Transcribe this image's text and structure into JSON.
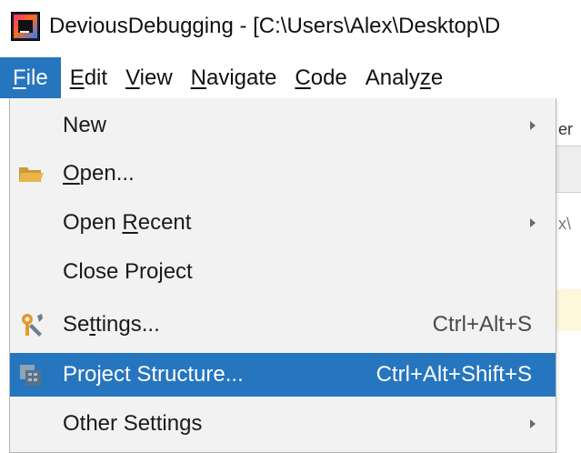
{
  "window": {
    "title": "DeviousDebugging - [C:\\Users\\Alex\\Desktop\\D"
  },
  "menubar": {
    "items": [
      {
        "label": "File",
        "mnemonic": "F",
        "rest": "ile"
      },
      {
        "label": "Edit",
        "mnemonic": "E",
        "rest": "dit"
      },
      {
        "label": "View",
        "mnemonic": "V",
        "rest": "iew"
      },
      {
        "label": "Navigate",
        "mnemonic": "N",
        "rest": "avigate"
      },
      {
        "label": "Code",
        "mnemonic": "C",
        "rest": "ode"
      },
      {
        "label": "Analyze",
        "pre": "Analy",
        "mnemonic": "z",
        "rest": "e"
      }
    ]
  },
  "file_menu": {
    "items": [
      {
        "label": "New",
        "has_submenu": true
      },
      {
        "pre": "",
        "mnemonic": "O",
        "rest": "pen...",
        "icon": "folder-icon"
      },
      {
        "pre": "Open ",
        "mnemonic": "R",
        "rest": "ecent",
        "has_submenu": true
      },
      {
        "label": "Close Project"
      },
      {
        "pre": "Se",
        "mnemonic": "t",
        "rest": "tings...",
        "shortcut": "Ctrl+Alt+S",
        "icon": "settings-wrench-icon"
      },
      {
        "label": "Project Structure...",
        "shortcut": "Ctrl+Alt+Shift+S",
        "icon": "project-structure-icon",
        "selected": true
      },
      {
        "label": "Other Settings",
        "has_submenu": true
      }
    ]
  },
  "background": {
    "frag_top": "er",
    "frag_mid": "x\\"
  },
  "colors": {
    "selection": "#2675bf",
    "menu_bg": "#f2f2f2"
  }
}
